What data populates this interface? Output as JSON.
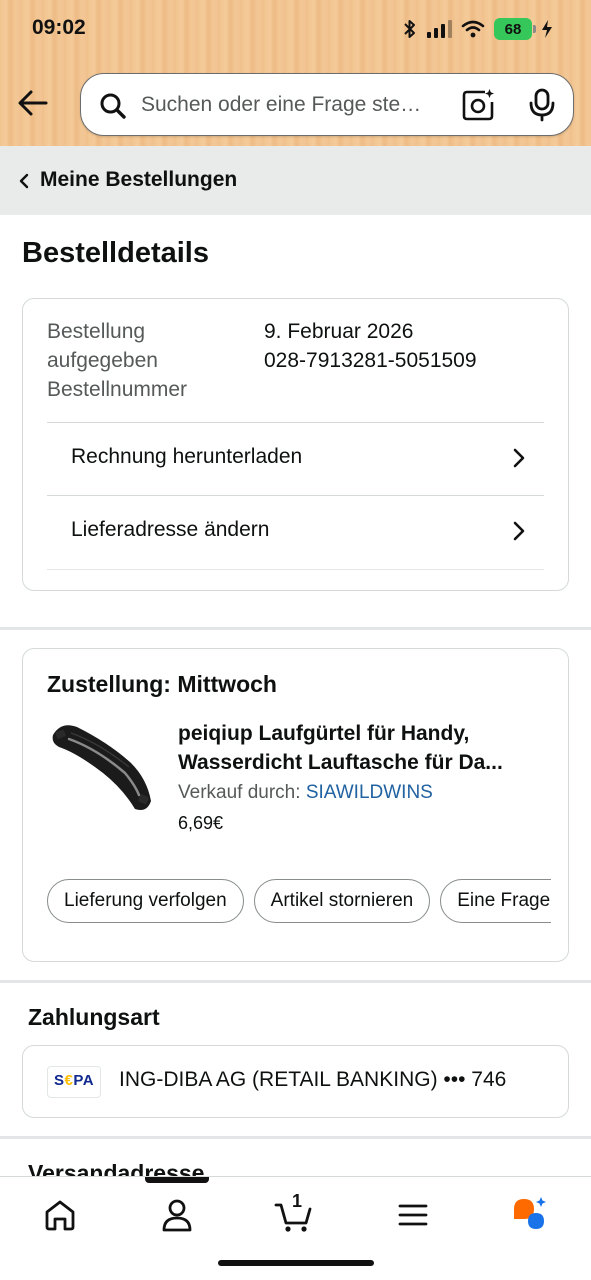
{
  "status_bar": {
    "time": "09:02",
    "battery": "68"
  },
  "search": {
    "placeholder": "Suchen oder eine Frage ste…"
  },
  "breadcrumb": {
    "label": "Meine Bestellungen"
  },
  "page": {
    "title": "Bestelldetails"
  },
  "order_info": {
    "labels": "Bestellung aufgegeben Bestellnummer",
    "date": "9. Februar 2026",
    "order_number": "028-7913281-5051509",
    "actions": [
      {
        "label": "Rechnung herunterladen"
      },
      {
        "label": "Lieferadresse ändern"
      }
    ]
  },
  "delivery": {
    "title": "Zustellung: Mittwoch",
    "product": {
      "title": "peiqiup Laufgürtel für Handy, Wasserdicht Lauftasche für Da...",
      "seller_prefix": "Verkauf durch:",
      "seller": "SIAWILDWINS",
      "price": "6,69€"
    },
    "buttons": [
      {
        "label": "Lieferung verfolgen"
      },
      {
        "label": "Artikel stornieren"
      },
      {
        "label": "Eine Frage stellen"
      }
    ]
  },
  "payment": {
    "section_title": "Zahlungsart",
    "logo_text": "SEPA",
    "method": "ING-DIBA AG (RETAIL BANKING) ••• 746"
  },
  "shipping": {
    "section_title": "Versandadresse"
  },
  "bottom_nav": {
    "cart_count": "1",
    "items": [
      "home-icon",
      "account-icon",
      "cart-icon",
      "menu-icon",
      "rufus-assistant-icon"
    ]
  },
  "colors": {
    "header_bg": "#f2c590",
    "link": "#2162a1",
    "battery": "#35c759",
    "divider": "#e3e6e6",
    "breadcrumb_bg": "#e9ebeb"
  }
}
